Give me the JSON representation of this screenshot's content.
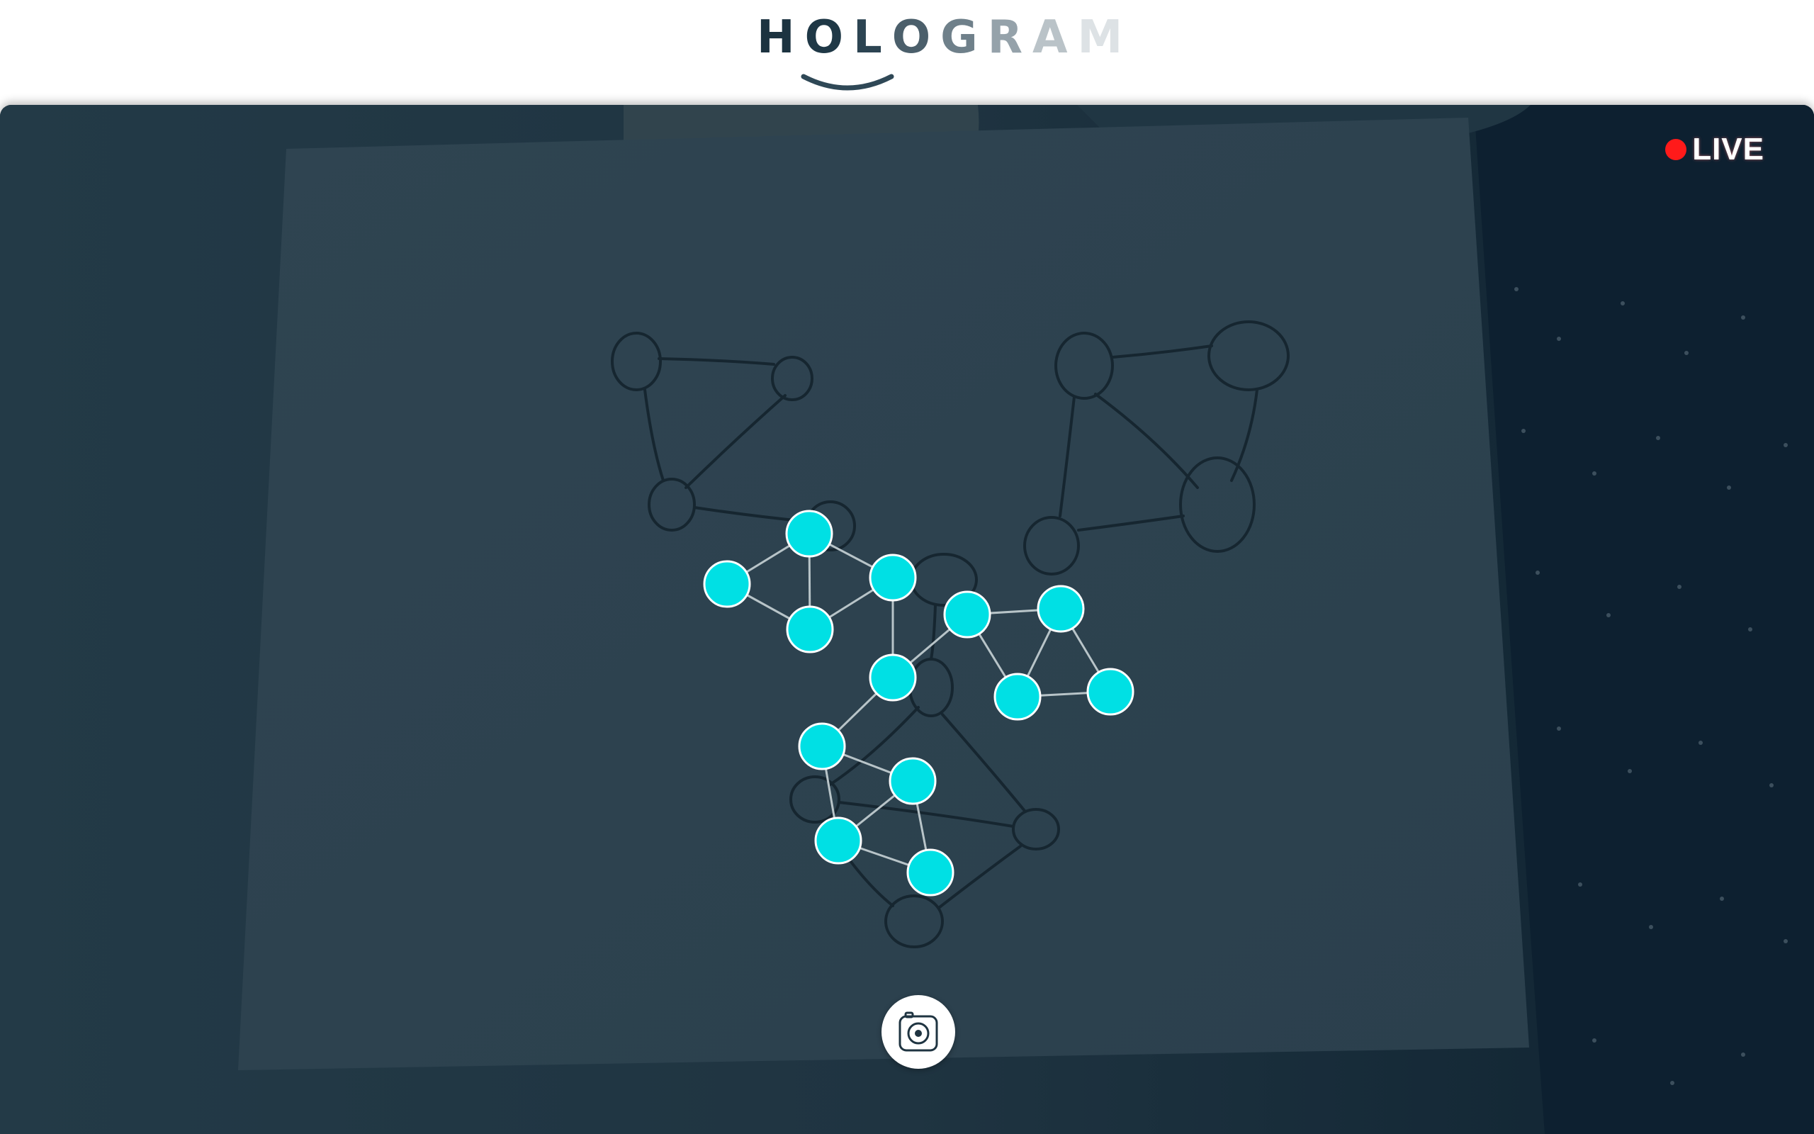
{
  "app": {
    "logo_text": "HOLOGRAM",
    "logo_letter_colors": [
      "#1c3340",
      "#1f3846",
      "#2c4452",
      "#4b5f6b",
      "#6f808a",
      "#95a2aa",
      "#bac3c8",
      "#dde2e5"
    ]
  },
  "stream": {
    "live_label": "LIVE",
    "live_color": "#ff1a1a"
  },
  "graph": {
    "node_color": "#00e0e4",
    "node_stroke": "#ffffff",
    "edge_color": "#b8c4c8"
  },
  "controls": {
    "capture_icon": "camera-icon"
  }
}
